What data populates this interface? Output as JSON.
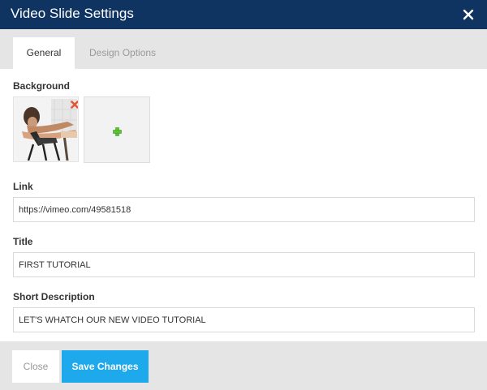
{
  "modal": {
    "title": "Video Slide Settings",
    "close_icon": "close-x-icon"
  },
  "tabs": [
    {
      "label": "General",
      "active": true
    },
    {
      "label": "Design Options",
      "active": false
    }
  ],
  "background": {
    "label": "Background",
    "remove_icon": "red-x-remove-icon",
    "add_icon": "green-plus-icon"
  },
  "link": {
    "label": "Link",
    "value": "https://vimeo.com/49581518"
  },
  "title_field": {
    "label": "Title",
    "value": "FIRST TUTORIAL"
  },
  "short_description": {
    "label": "Short Description",
    "value": "LET'S WHATCH OUR NEW VIDEO TUTORIAL"
  },
  "footer": {
    "close_label": "Close",
    "save_label": "Save Changes"
  },
  "colors": {
    "header_bg": "#0f3461",
    "primary_button": "#1ea9ec",
    "tab_bar_bg": "#e5e5e5",
    "remove_icon": "#e05a3a",
    "add_icon": "#5bc236"
  }
}
